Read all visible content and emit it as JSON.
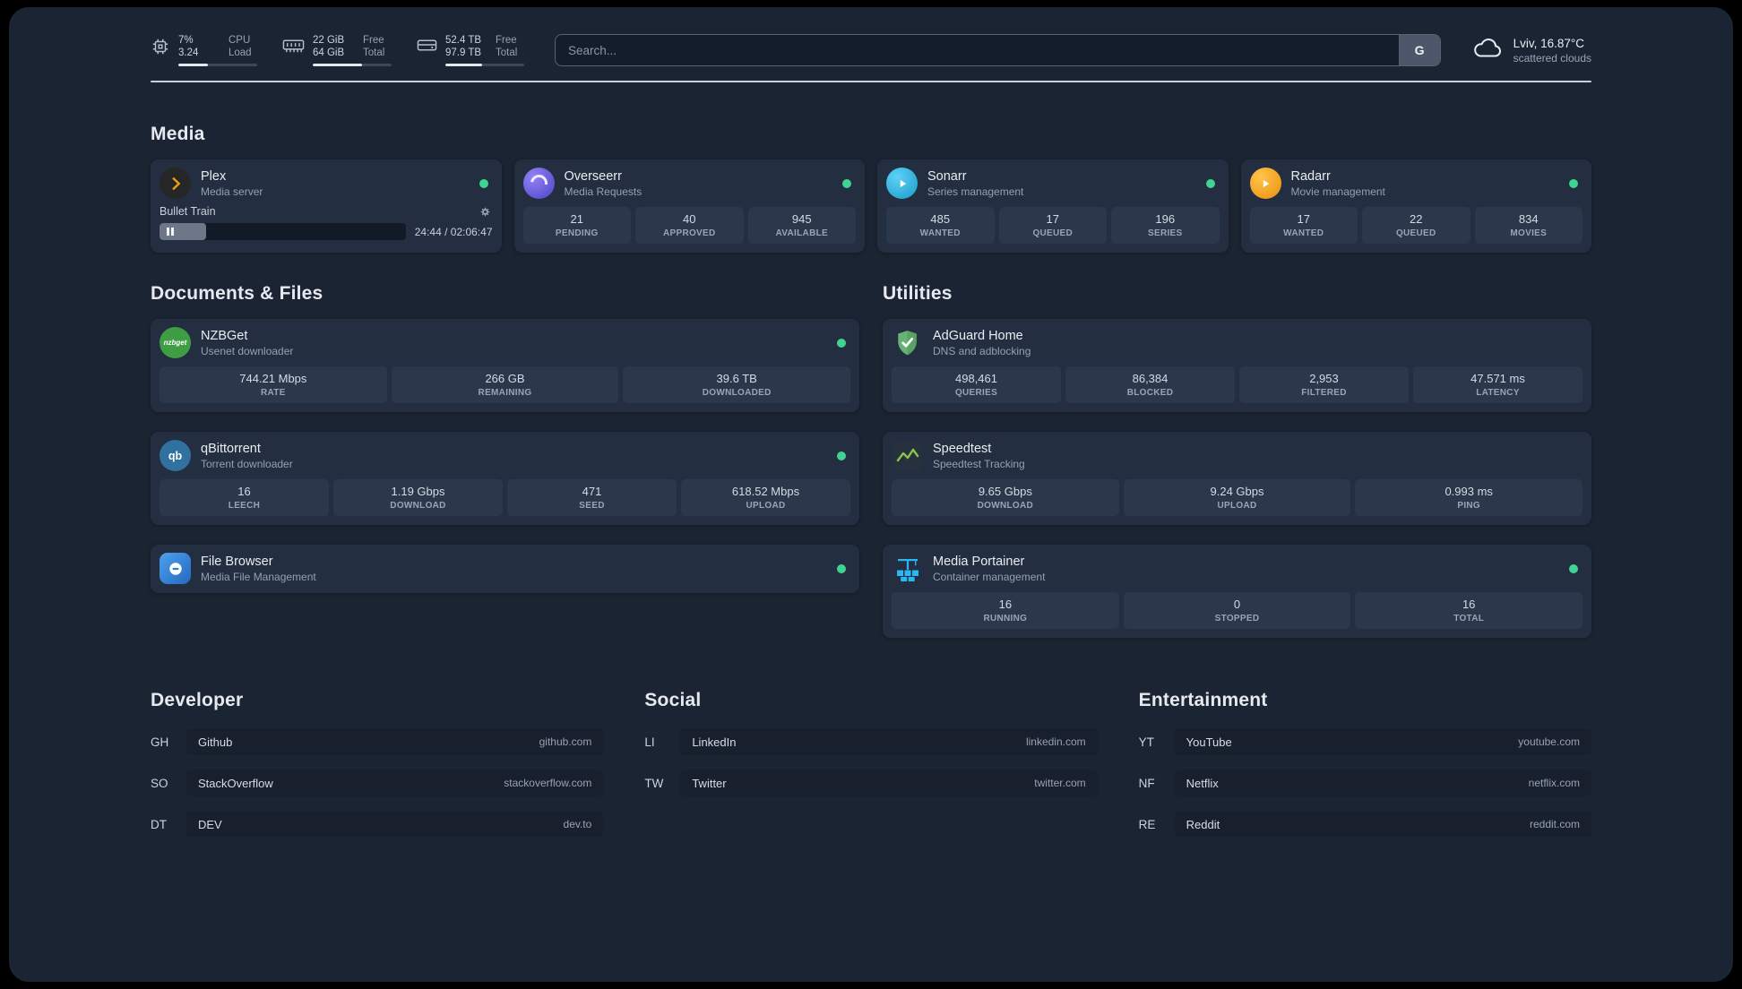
{
  "colors": {
    "page_bg": "#1b2433",
    "card_bg": "#232e40",
    "stat_tile_bg": "#2b374b",
    "status_online": "#41d392",
    "plex_accent": "#e5a00d",
    "overseerr_accent": "#6d5ff5",
    "sonarr_accent": "#35c5f4",
    "radarr_accent": "#f7a01b",
    "nzbget_accent": "#3f9e44",
    "qbittorrent_accent": "#30719f",
    "filebrowser_accent": "#2d7dd2",
    "adguard_accent": "#67b279",
    "speedtest_accent": "#8bc34a",
    "portainer_accent": "#29b8f5"
  },
  "topbar": {
    "cpu": {
      "icon": "cpu-icon",
      "value_top": "7%",
      "value_bottom": "3.24",
      "label_top": "CPU",
      "label_bottom": "Load",
      "percent": 38
    },
    "memory": {
      "icon": "memory-icon",
      "value_top": "22 GiB",
      "value_bottom": "64 GiB",
      "label_top": "Free",
      "label_bottom": "Total",
      "percent": 62
    },
    "disk": {
      "icon": "disk-icon",
      "value_top": "52.4 TB",
      "value_bottom": "97.9 TB",
      "label_top": "Free",
      "label_bottom": "Total",
      "percent": 47
    },
    "search": {
      "placeholder": "Search...",
      "provider_button": "G"
    },
    "weather": {
      "icon": "cloud-icon",
      "location": "Lviv, 16.87°C",
      "condition": "scattered clouds"
    }
  },
  "media": {
    "title": "Media",
    "plex": {
      "name": "Plex",
      "desc": "Media server",
      "icon": "plex-icon",
      "online": true,
      "player": {
        "title": "Bullet Train",
        "time": "24:44 / 02:06:47",
        "progress_percent": 19
      }
    },
    "overseerr": {
      "name": "Overseerr",
      "desc": "Media Requests",
      "icon": "overseerr-icon",
      "online": true,
      "stats": [
        {
          "value": "21",
          "label": "PENDING"
        },
        {
          "value": "40",
          "label": "APPROVED"
        },
        {
          "value": "945",
          "label": "AVAILABLE"
        }
      ]
    },
    "sonarr": {
      "name": "Sonarr",
      "desc": "Series management",
      "icon": "sonarr-icon",
      "online": true,
      "stats": [
        {
          "value": "485",
          "label": "WANTED"
        },
        {
          "value": "17",
          "label": "QUEUED"
        },
        {
          "value": "196",
          "label": "SERIES"
        }
      ]
    },
    "radarr": {
      "name": "Radarr",
      "desc": "Movie management",
      "icon": "radarr-icon",
      "online": true,
      "stats": [
        {
          "value": "17",
          "label": "WANTED"
        },
        {
          "value": "22",
          "label": "QUEUED"
        },
        {
          "value": "834",
          "label": "MOVIES"
        }
      ]
    }
  },
  "documents": {
    "title": "Documents & Files",
    "nzbget": {
      "name": "NZBGet",
      "desc": "Usenet downloader",
      "icon": "nzbget-icon",
      "icon_text": "nzbget",
      "online": true,
      "stats": [
        {
          "value": "744.21 Mbps",
          "label": "RATE"
        },
        {
          "value": "266 GB",
          "label": "REMAINING"
        },
        {
          "value": "39.6 TB",
          "label": "DOWNLOADED"
        }
      ]
    },
    "qbittorrent": {
      "name": "qBittorrent",
      "desc": "Torrent downloader",
      "icon": "qbittorrent-icon",
      "icon_text": "qb",
      "online": true,
      "stats": [
        {
          "value": "16",
          "label": "LEECH"
        },
        {
          "value": "1.19 Gbps",
          "label": "DOWNLOAD"
        },
        {
          "value": "471",
          "label": "SEED"
        },
        {
          "value": "618.52 Mbps",
          "label": "UPLOAD"
        }
      ]
    },
    "filebrowser": {
      "name": "File Browser",
      "desc": "Media File Management",
      "icon": "filebrowser-icon",
      "online": true
    }
  },
  "utilities": {
    "title": "Utilities",
    "adguard": {
      "name": "AdGuard Home",
      "desc": "DNS and adblocking",
      "icon": "adguard-icon",
      "stats": [
        {
          "value": "498,461",
          "label": "QUERIES"
        },
        {
          "value": "86,384",
          "label": "BLOCKED"
        },
        {
          "value": "2,953",
          "label": "FILTERED"
        },
        {
          "value": "47.571 ms",
          "label": "LATENCY"
        }
      ]
    },
    "speedtest": {
      "name": "Speedtest",
      "desc": "Speedtest Tracking",
      "icon": "speedtest-icon",
      "stats": [
        {
          "value": "9.65 Gbps",
          "label": "DOWNLOAD"
        },
        {
          "value": "9.24 Gbps",
          "label": "UPLOAD"
        },
        {
          "value": "0.993 ms",
          "label": "PING"
        }
      ]
    },
    "portainer": {
      "name": "Media Portainer",
      "desc": "Container management",
      "icon": "portainer-icon",
      "online": true,
      "stats": [
        {
          "value": "16",
          "label": "RUNNING"
        },
        {
          "value": "0",
          "label": "STOPPED"
        },
        {
          "value": "16",
          "label": "TOTAL"
        }
      ]
    }
  },
  "bookmarks": {
    "developer": {
      "title": "Developer",
      "items": [
        {
          "abbr": "GH",
          "name": "Github",
          "url": "github.com"
        },
        {
          "abbr": "SO",
          "name": "StackOverflow",
          "url": "stackoverflow.com"
        },
        {
          "abbr": "DT",
          "name": "DEV",
          "url": "dev.to"
        }
      ]
    },
    "social": {
      "title": "Social",
      "items": [
        {
          "abbr": "LI",
          "name": "LinkedIn",
          "url": "linkedin.com"
        },
        {
          "abbr": "TW",
          "name": "Twitter",
          "url": "twitter.com"
        }
      ]
    },
    "entertainment": {
      "title": "Entertainment",
      "items": [
        {
          "abbr": "YT",
          "name": "YouTube",
          "url": "youtube.com"
        },
        {
          "abbr": "NF",
          "name": "Netflix",
          "url": "netflix.com"
        },
        {
          "abbr": "RE",
          "name": "Reddit",
          "url": "reddit.com"
        }
      ]
    }
  }
}
